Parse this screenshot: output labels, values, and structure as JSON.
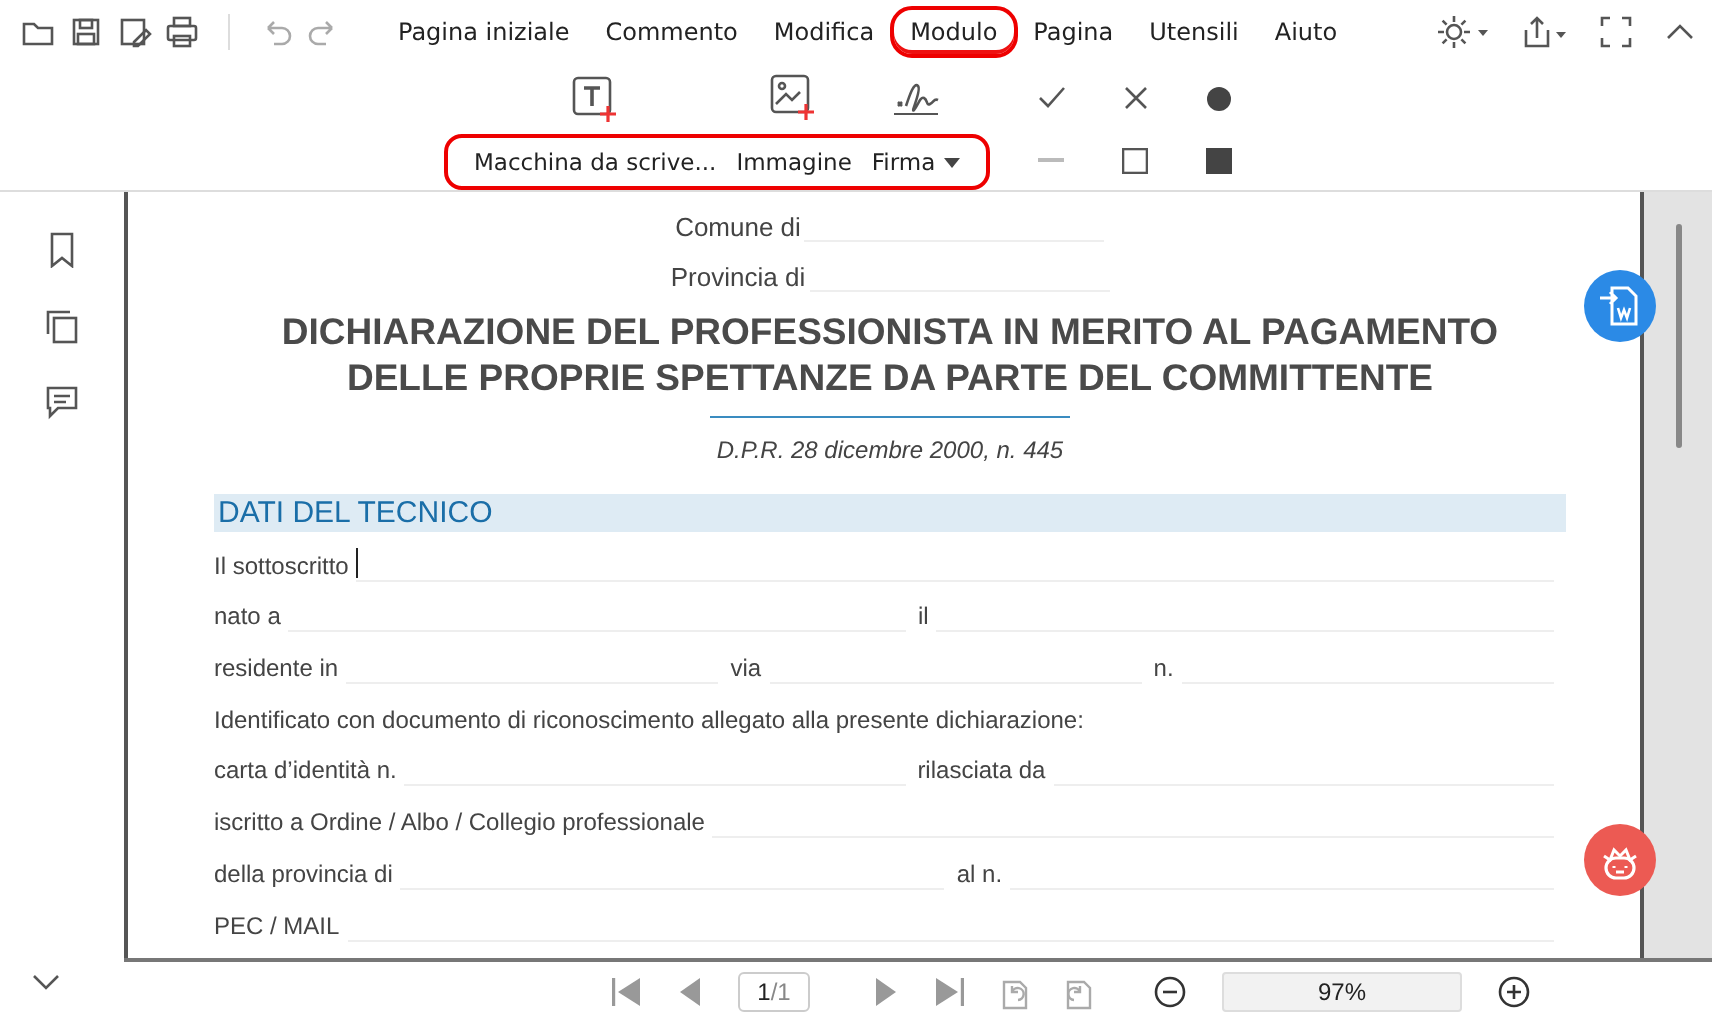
{
  "menu": {
    "tabs": [
      {
        "label": "Pagina iniziale",
        "selected": false,
        "circled": false
      },
      {
        "label": "Commento",
        "selected": false,
        "circled": false
      },
      {
        "label": "Modifica",
        "selected": false,
        "circled": false
      },
      {
        "label": "Modulo",
        "selected": true,
        "circled": true
      },
      {
        "label": "Pagina",
        "selected": false,
        "circled": false
      },
      {
        "label": "Utensili",
        "selected": false,
        "circled": false
      },
      {
        "label": "Aiuto",
        "selected": false,
        "circled": false
      }
    ]
  },
  "ribbon": {
    "circled": true,
    "tools": [
      {
        "kind": "typewriter",
        "label": "Macchina da scrive..."
      },
      {
        "kind": "image",
        "label": "Immagine"
      },
      {
        "kind": "signature",
        "label": "Firma",
        "dropdown": true
      }
    ]
  },
  "document": {
    "header_rows": [
      {
        "label": "Comune di"
      },
      {
        "label": "Provincia di"
      }
    ],
    "title": [
      "DICHIARAZIONE DEL PROFESSIONISTA IN MERITO AL PAGAMENTO",
      "DELLE PROPRIE SPETTANZE DA PARTE DEL COMMITTENTE"
    ],
    "subtitle": "D.P.R. 28 dicembre 2000, n. 445",
    "section": "DATI DEL TECNICO",
    "rows": [
      {
        "parts": [
          {
            "kind": "text",
            "text": "Il sottoscritto"
          },
          {
            "kind": "blank",
            "caret": true
          }
        ]
      },
      {
        "parts": [
          {
            "kind": "text",
            "text": "nato a"
          },
          {
            "kind": "blank"
          },
          {
            "kind": "text",
            "text": "il"
          },
          {
            "kind": "blank"
          }
        ]
      },
      {
        "parts": [
          {
            "kind": "text",
            "text": "residente  in"
          },
          {
            "kind": "blank"
          },
          {
            "kind": "text",
            "text": "via"
          },
          {
            "kind": "blank"
          },
          {
            "kind": "text",
            "text": "n."
          },
          {
            "kind": "blank"
          }
        ]
      },
      {
        "parts": [
          {
            "kind": "text",
            "text": "Identificato con documento di riconoscimento allegato alla presente dichiarazione:"
          }
        ]
      },
      {
        "parts": [
          {
            "kind": "text",
            "text": "carta d’identità n."
          },
          {
            "kind": "blank"
          },
          {
            "kind": "text",
            "text": "rilasciata da"
          },
          {
            "kind": "blank"
          }
        ]
      },
      {
        "parts": [
          {
            "kind": "text",
            "text": "iscritto a Ordine / Albo / Collegio professionale"
          },
          {
            "kind": "blank"
          }
        ]
      },
      {
        "parts": [
          {
            "kind": "text",
            "text": "della  provincia  di"
          },
          {
            "kind": "blank"
          },
          {
            "kind": "text",
            "text": "al  n."
          },
          {
            "kind": "blank"
          }
        ]
      },
      {
        "parts": [
          {
            "kind": "text",
            "text": "PEC / MAIL"
          },
          {
            "kind": "blank"
          }
        ]
      }
    ]
  },
  "navigation": {
    "page": "1",
    "total": "/1",
    "zoom": "97%"
  }
}
